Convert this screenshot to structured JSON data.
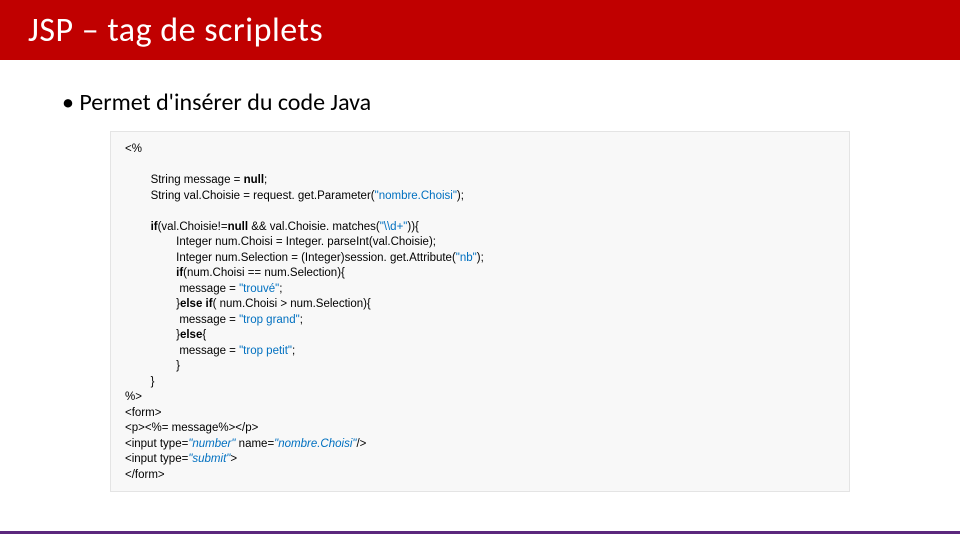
{
  "title": "JSP – tag de scriplets",
  "bullet": "Permet d'insérer du code Java",
  "code": {
    "l1": "<%",
    "l2": "String message = ",
    "l2b": "null",
    "l2c": ";",
    "l3": "String val.Choisie = request. get.Parameter(",
    "l3s": "\"nombre.Choisi\"",
    "l3c": ");",
    "l4a": "if",
    "l4b": "(val.Choisie!=",
    "l4c": "null ",
    "l4d": "&& val.Choisie. matches(",
    "l4s": "\"\\\\d+\"",
    "l4e": ")){",
    "l5": "Integer num.Choisi = Integer. parseInt(val.Choisie);",
    "l6a": "Integer num.Selection = (Integer)session. get.Attribute(",
    "l6s": "\"nb\"",
    "l6b": ");",
    "l7a": "if",
    "l7b": "(num.Choisi == num.Selection){",
    "l8a": " message = ",
    "l8s": "\"trouvé\"",
    "l8b": ";",
    "l9a": "}",
    "l9b": "else if",
    "l9c": "( num.Choisi > num.Selection){",
    "l10a": " message = ",
    "l10s": "\"trop grand\"",
    "l10b": ";",
    "l11a": "}",
    "l11b": "else",
    "l11c": "{",
    "l12a": " message = ",
    "l12s": "\"trop petit\"",
    "l12b": ";",
    "l13": " }",
    "l14": "}",
    "l15": "%>",
    "l16": "<form>",
    "l17": "<p><%= message%></p>",
    "l18a": "<input type=",
    "l18s1": "\"number\" ",
    "l18b": "name=",
    "l18s2": "\"nombre.Choisi\"",
    "l18c": "/>",
    "l19a": "<input type=",
    "l19s": "\"submit\"",
    "l19b": ">",
    "l20": "</form>"
  }
}
